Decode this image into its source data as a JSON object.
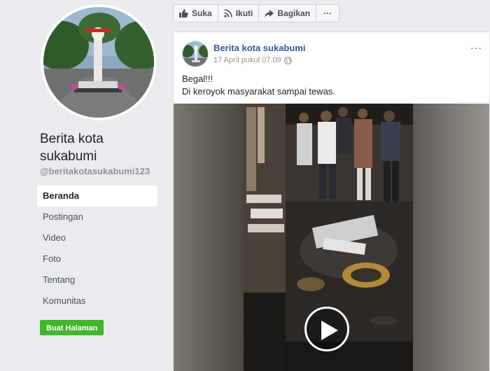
{
  "sidebar": {
    "page_name": "Berita kota sukabumi",
    "handle": "@beritakotasukabumi123",
    "nav": [
      {
        "label": "Beranda",
        "active": true
      },
      {
        "label": "Postingan"
      },
      {
        "label": "Video"
      },
      {
        "label": "Foto"
      },
      {
        "label": "Tentang"
      },
      {
        "label": "Komunitas"
      }
    ],
    "create_button": "Buat Halaman"
  },
  "actionbar": {
    "like": "Suka",
    "follow": "Ikuti",
    "share": "Bagikan",
    "more": "···"
  },
  "post": {
    "author": "Berita kota sukabumi",
    "time": "17 April pukul 07.09",
    "more": "···",
    "text_line1": "Begal!!!",
    "text_line2": "Di keroyok masyarakat sampai tewas."
  },
  "colors": {
    "link": "#365899",
    "green": "#42b72a",
    "background": "#e9ebee"
  },
  "icons": [
    "like-icon",
    "rss-icon",
    "share-icon",
    "globe-icon",
    "play-icon"
  ]
}
